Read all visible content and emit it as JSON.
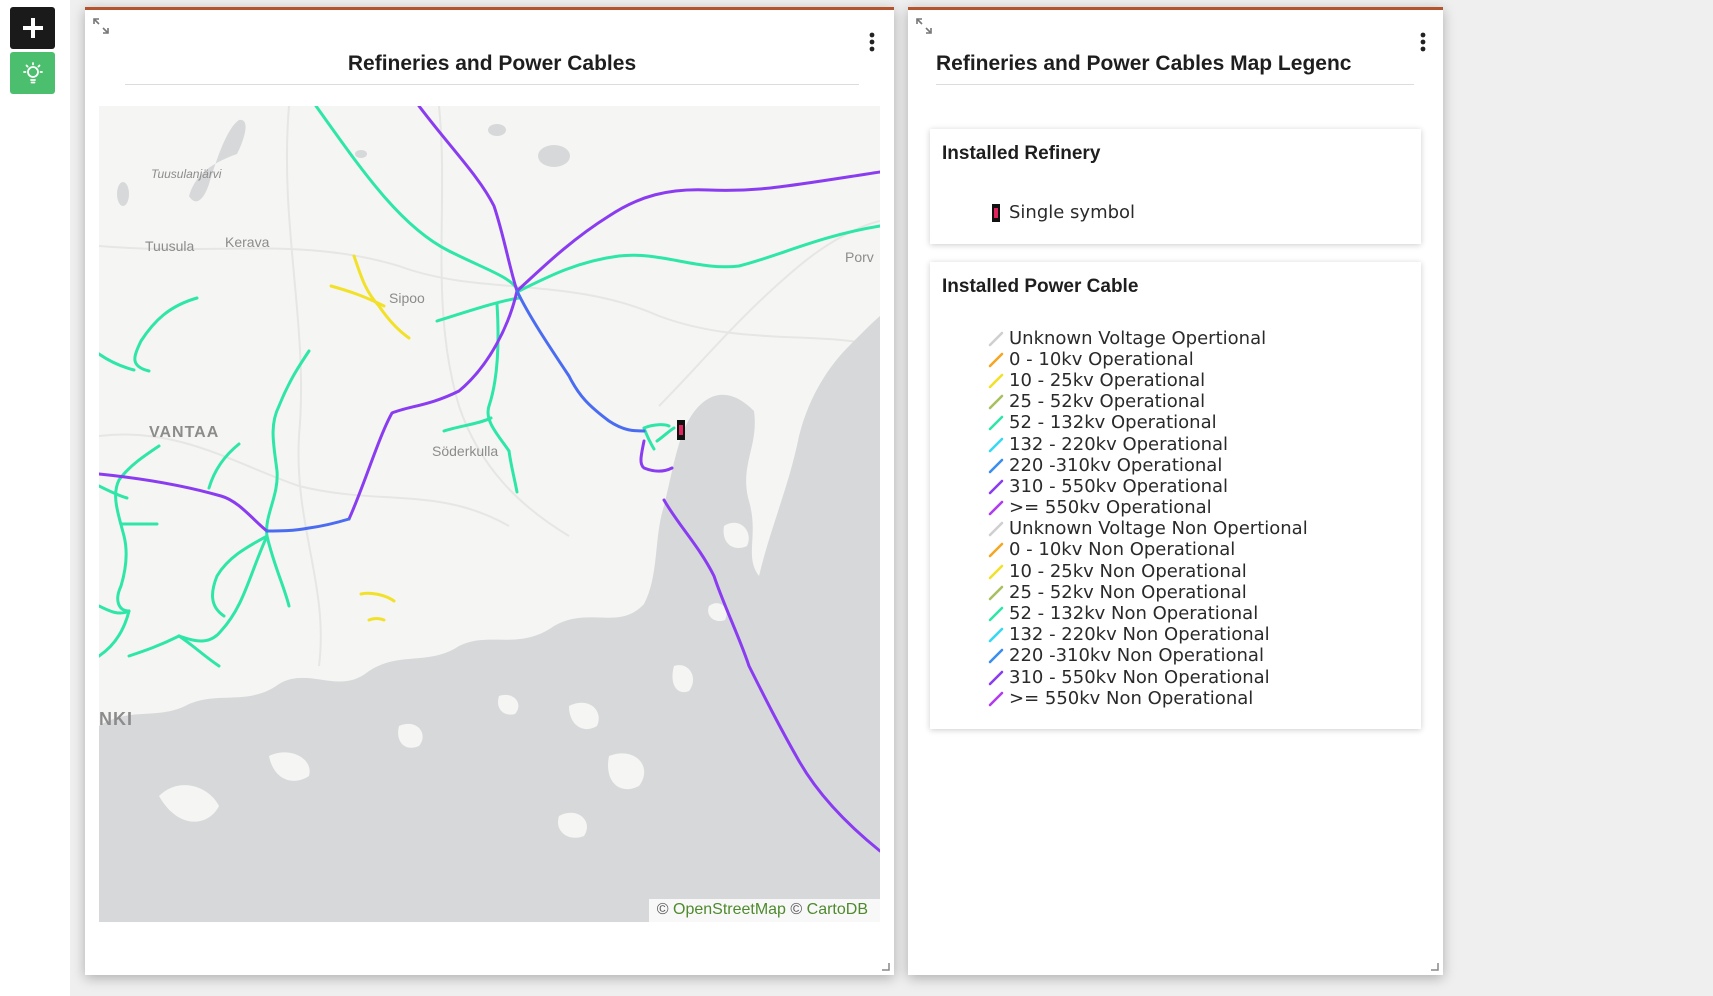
{
  "toolbar": {
    "add_icon": "plus-icon",
    "theme_icon": "lightbulb-icon",
    "theme_color": "#4cbf6e"
  },
  "map_panel": {
    "title": "Refineries and Power Cables",
    "expand_icon": "expand-icon",
    "menu_icon": "kebab-menu-icon",
    "accent_color": "#b4542f",
    "place_labels": {
      "tuusulanjarvi": "Tuusulanjärvi",
      "tuusula": "Tuusula",
      "kerava": "Kerava",
      "sipoo": "Sipoo",
      "vantaa": "VANTAA",
      "soderkulla": "Söderkulla",
      "porvoo": "Porv",
      "helsinki": "NKI"
    },
    "attribution": {
      "prefix_1": "© ",
      "osm": "OpenStreetMap",
      "prefix_2": " © ",
      "carto": "CartoDB"
    },
    "basemap": "CartoDB light",
    "colors": {
      "land": "#f5f5f3",
      "water": "#d7d8da",
      "green_cable": "#2ee6a8",
      "purple_cable": "#8a3cf0",
      "blue_cable": "#4a6cf0",
      "yellow_cable": "#f2e12a",
      "refinery_symbol": "#e0245e"
    }
  },
  "legend_panel": {
    "title": "Refineries and Power Cables Map Legenc",
    "refinery": {
      "heading": "Installed Refinery",
      "items": [
        {
          "label": "Single symbol",
          "icon": "refinery-marker-icon",
          "color": "#e0245e"
        }
      ]
    },
    "cable": {
      "heading": "Installed Power Cable",
      "items": [
        {
          "label": "Unknown Voltage Opertional",
          "color": "#cfcfcf"
        },
        {
          "label": "0 - 10kv Operational",
          "color": "#f5a623"
        },
        {
          "label": "10 - 25kv Operational",
          "color": "#f2e12a"
        },
        {
          "label": "25 - 52kv Operational",
          "color": "#a8c060"
        },
        {
          "label": "52 - 132kv Operational",
          "color": "#2ee6a8"
        },
        {
          "label": "132 - 220kv Operational",
          "color": "#38d8f0"
        },
        {
          "label": "220 -310kv Operational",
          "color": "#3a8ef0"
        },
        {
          "label": "310 - 550kv Operational",
          "color": "#8a3cf0"
        },
        {
          "label": ">= 550kv Operational",
          "color": "#b03cf0"
        },
        {
          "label": "Unknown Voltage Non Opertional",
          "color": "#cfcfcf"
        },
        {
          "label": "0 - 10kv Non Operational",
          "color": "#f5a623"
        },
        {
          "label": "10 - 25kv Non Operational",
          "color": "#f2e12a"
        },
        {
          "label": "25 - 52kv Non Operational",
          "color": "#a8c060"
        },
        {
          "label": "52 - 132kv Non Operational",
          "color": "#2ee6a8"
        },
        {
          "label": "132 - 220kv Non Operational",
          "color": "#38d8f0"
        },
        {
          "label": "220 -310kv Non Operational",
          "color": "#3a8ef0"
        },
        {
          "label": "310 - 550kv Non Operational",
          "color": "#8a3cf0"
        },
        {
          "label": ">= 550kv Non Operational",
          "color": "#b03cf0"
        }
      ]
    }
  }
}
